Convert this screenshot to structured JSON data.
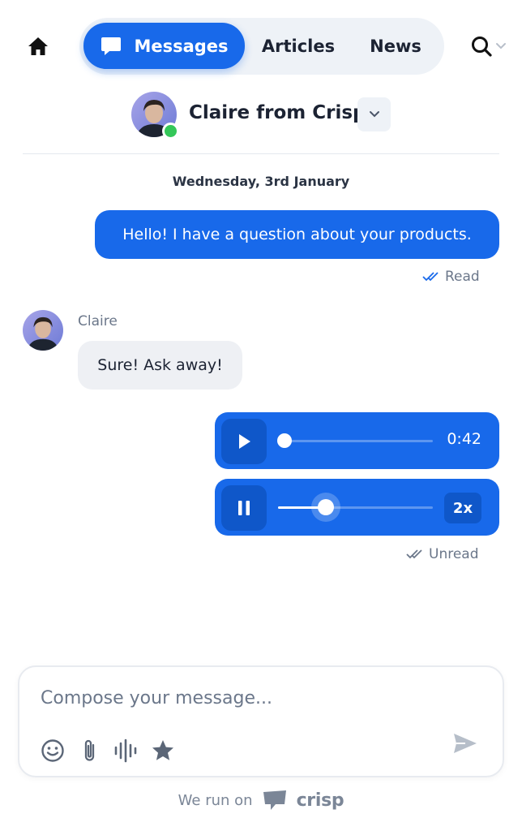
{
  "nav": {
    "tabs": [
      {
        "label": "Messages",
        "active": true
      },
      {
        "label": "Articles",
        "active": false
      },
      {
        "label": "News",
        "active": false
      }
    ],
    "accent_color": "#1869ea"
  },
  "agent": {
    "name": "Claire from Crisp",
    "status": "online"
  },
  "conversation": {
    "date": "Wednesday, 3rd January",
    "messages": [
      {
        "from": "visitor",
        "type": "text",
        "text": "Hello! I have a question about your products.",
        "status": "Read"
      },
      {
        "from": "operator",
        "sender": "Claire",
        "type": "text",
        "text": "Sure! Ask away!"
      },
      {
        "from": "visitor",
        "type": "audio",
        "state": "paused",
        "progress": 0.0,
        "time": "0:42"
      },
      {
        "from": "visitor",
        "type": "audio",
        "state": "playing",
        "progress": 0.31,
        "speed": "2x",
        "status": "Unread"
      }
    ]
  },
  "composer": {
    "placeholder": "Compose your message...",
    "value": "",
    "tools": [
      "emoji-icon",
      "attachment-icon",
      "voice-icon",
      "star-icon"
    ]
  },
  "footer": {
    "prefix": "We run on",
    "brand": "crisp"
  }
}
